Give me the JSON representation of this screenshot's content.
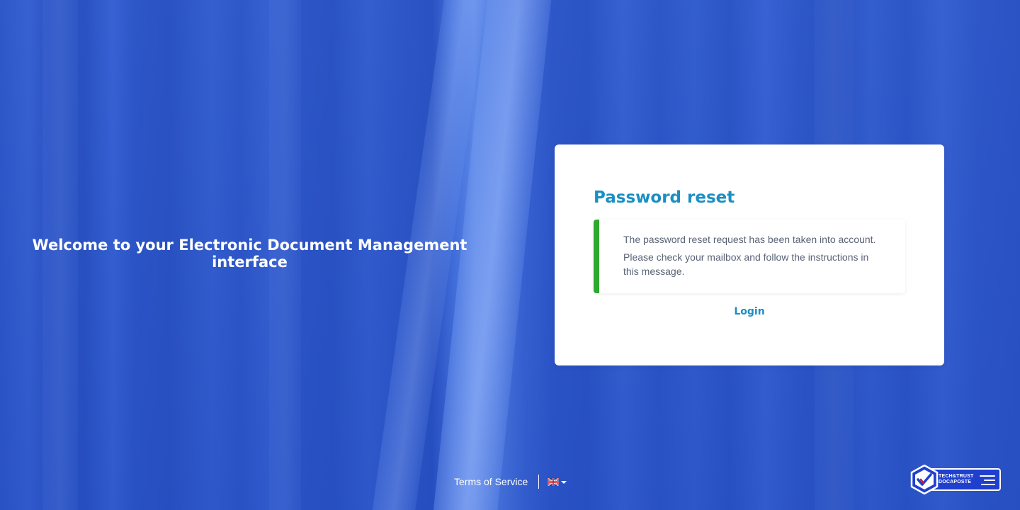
{
  "welcome": {
    "text": "Welcome to your Electronic Document Management interface"
  },
  "card": {
    "title": "Password reset",
    "alert": {
      "line1": "The password reset request has been taken into account.",
      "line2": "Please check your mailbox and follow the instructions in this message.",
      "accent_color": "#2ea82e"
    },
    "login_label": "Login"
  },
  "footer": {
    "terms_label": "Terms of Service",
    "language_icon": "uk-flag-icon"
  },
  "badge": {
    "line1": "TECH&TRUST",
    "line2": "DOCAPOSTE"
  },
  "colors": {
    "accent": "#1a8fc4",
    "background": "#3a63d4",
    "success": "#2ea82e"
  }
}
